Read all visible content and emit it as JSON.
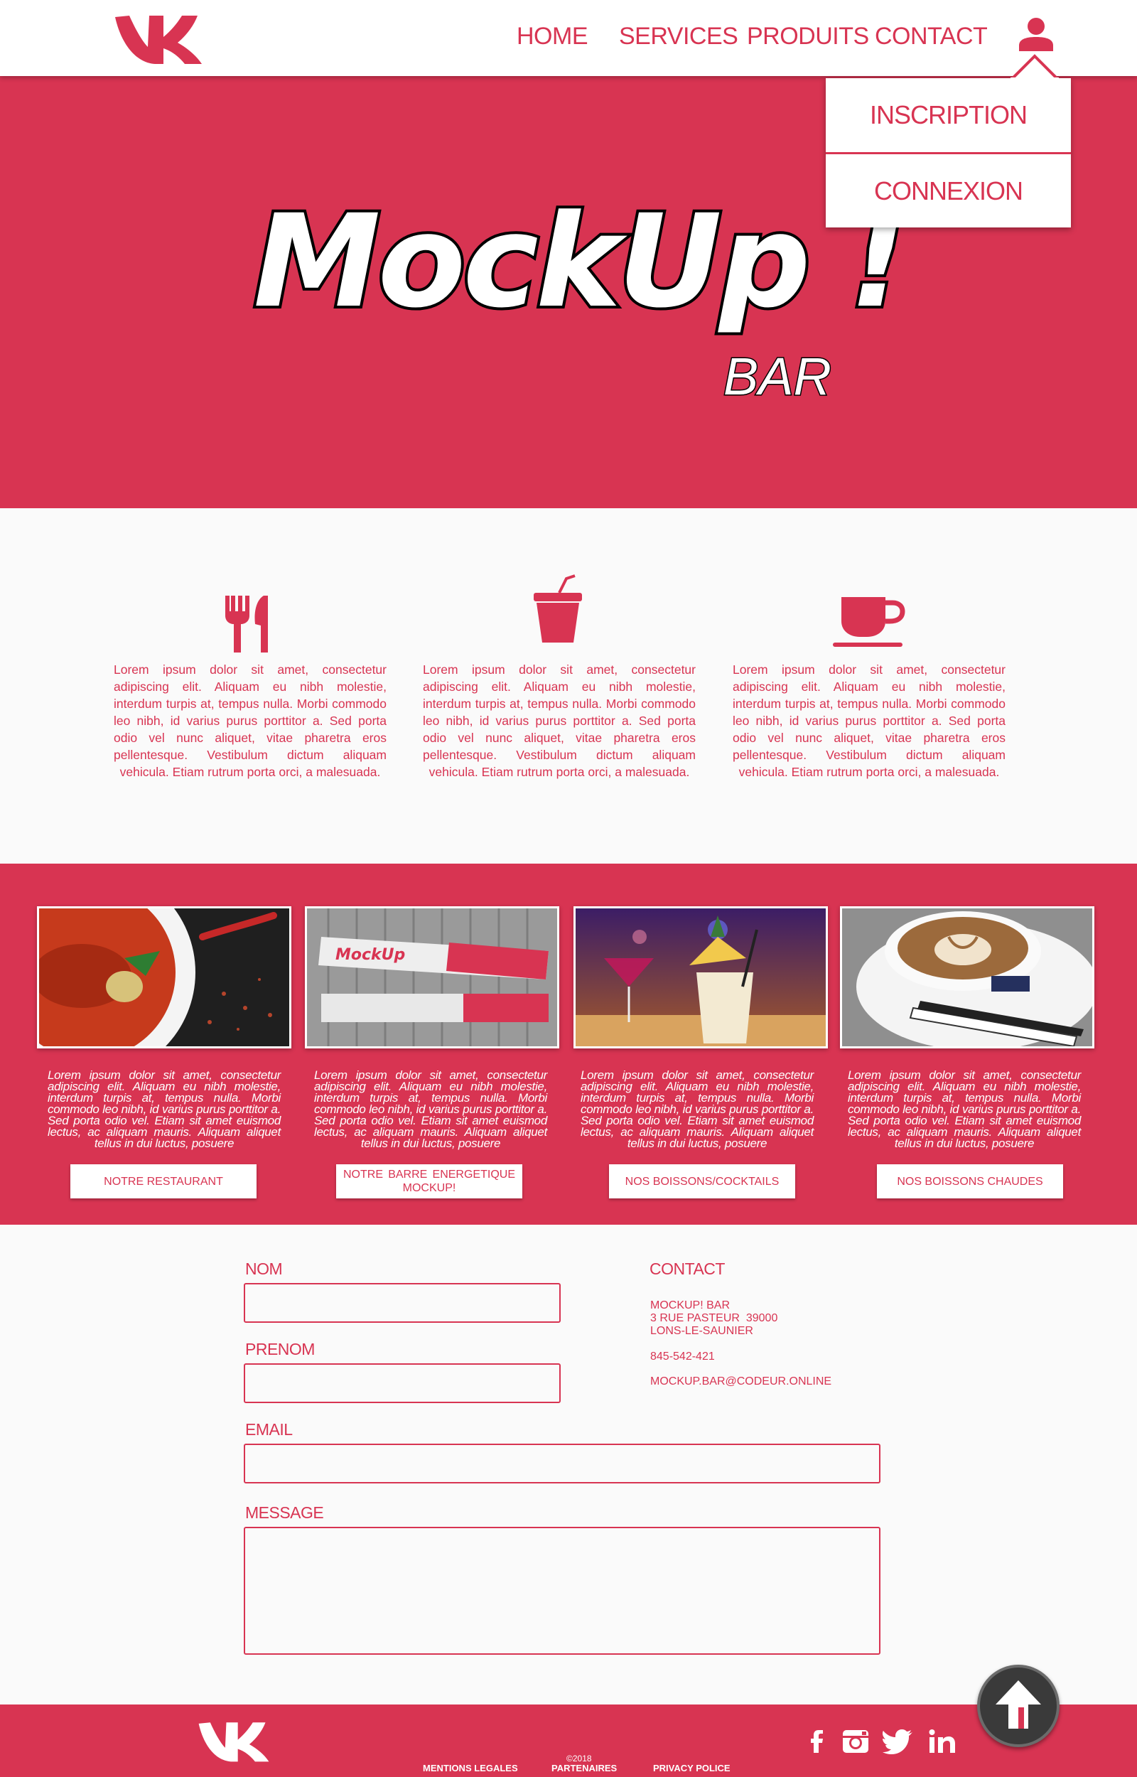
{
  "nav": {
    "items": [
      "HOME",
      "SERVICES",
      "PRODUITS",
      "CONTACT"
    ]
  },
  "account_menu": {
    "items": [
      "INSCRIPTION",
      "CONNEXION"
    ]
  },
  "hero": {
    "title": "MockUp !",
    "subtitle": "BAR"
  },
  "features": [
    {
      "icon": "cutlery-icon",
      "text": "Lorem ipsum dolor sit amet, consectetur adipiscing elit. Aliquam eu nibh molestie, interdum turpis at, tempus nulla. Morbi commodo leo nibh, id varius purus porttitor a. Sed porta odio vel nunc aliquet, vitae pharetra eros pellentesque. Vestibulum dictum aliquam vehicula. Etiam rutrum porta orci, a malesuada."
    },
    {
      "icon": "drink-cup-icon",
      "text": "Lorem ipsum dolor sit amet, consectetur adipiscing elit. Aliquam eu nibh molestie, interdum turpis at, tempus nulla. Morbi commodo leo nibh, id varius purus porttitor a. Sed porta odio vel nunc aliquet, vitae pharetra eros pellentesque. Vestibulum dictum aliquam vehicula. Etiam rutrum porta orci, a malesuada."
    },
    {
      "icon": "coffee-cup-icon",
      "text": "Lorem ipsum dolor sit amet, consectetur adipiscing elit. Aliquam eu nibh molestie, interdum turpis at, tempus nulla. Morbi commodo leo nibh, id varius purus porttitor a. Sed porta odio vel nunc aliquet, vitae pharetra eros pellentesque. Vestibulum dictum aliquam vehicula. Etiam rutrum porta orci, a malesuada."
    }
  ],
  "products": [
    {
      "photo": "soup-photo",
      "text": "Lorem ipsum dolor sit amet, consectetur adipiscing elit. Aliquam eu nibh molestie, interdum turpis at, tempus nulla. Morbi commodo leo nibh, id varius purus porttitor a. Sed porta odio vel. Etiam sit amet euismod lectus, ac aliquam mauris. Aliquam aliquet tellus in dui luctus, posuere",
      "button": "NOTRE RESTAURANT"
    },
    {
      "photo": "energy-bar-photo",
      "photo_label": "MockUp",
      "text": "Lorem ipsum dolor sit amet, consectetur adipiscing elit. Aliquam eu nibh molestie, interdum turpis at, tempus nulla. Morbi commodo leo nibh, id varius purus porttitor a. Sed porta odio vel. Etiam sit amet euismod lectus, ac aliquam mauris. Aliquam aliquet tellus in dui luctus, posuere",
      "button_words": [
        "NOTRE",
        "BARRE",
        "ENERGETIQUE"
      ],
      "button_line2": "MOCKUP!"
    },
    {
      "photo": "cocktails-photo",
      "text": "Lorem ipsum dolor sit amet, consectetur adipiscing elit. Aliquam eu nibh molestie, interdum turpis at, tempus nulla. Morbi commodo leo nibh, id varius purus porttitor a. Sed porta odio vel. Etiam sit amet euismod lectus, ac aliquam mauris. Aliquam aliquet tellus in dui luctus, posuere",
      "button": "NOS BOISSONS/COCKTAILS"
    },
    {
      "photo": "cappuccino-photo",
      "text": "Lorem ipsum dolor sit amet, consectetur adipiscing elit. Aliquam eu nibh molestie, interdum turpis at, tempus nulla. Morbi commodo leo nibh, id varius purus porttitor a. Sed porta odio vel. Etiam sit amet euismod lectus, ac aliquam mauris. Aliquam aliquet tellus in dui luctus, posuere",
      "button": "NOS BOISSONS CHAUDES"
    }
  ],
  "form": {
    "nom_label": "NOM",
    "nom_value": "",
    "prenom_label": "PRENOM",
    "prenom_value": "",
    "email_label": "EMAIL",
    "email_value": "",
    "message_label": "MESSAGE",
    "message_value": ""
  },
  "contact": {
    "heading": "CONTACT",
    "name": "MOCKUP! BAR",
    "street": "3 RUE PASTEUR  39000",
    "city": "LONS-LE-SAUNIER",
    "phone": "845-542-421",
    "email": "MOCKUP.BAR@CODEUR.ONLINE"
  },
  "footer": {
    "copyright": "©2018",
    "links": [
      "MENTIONS LEGALES",
      "PARTENAIRES",
      "PRIVACY POLICE"
    ],
    "social": [
      "facebook-icon",
      "instagram-icon",
      "twitter-icon",
      "linkedin-icon"
    ]
  },
  "colors": {
    "accent": "#d83452",
    "background": "#fafafa",
    "scroll_button": "#3a3a3a"
  }
}
